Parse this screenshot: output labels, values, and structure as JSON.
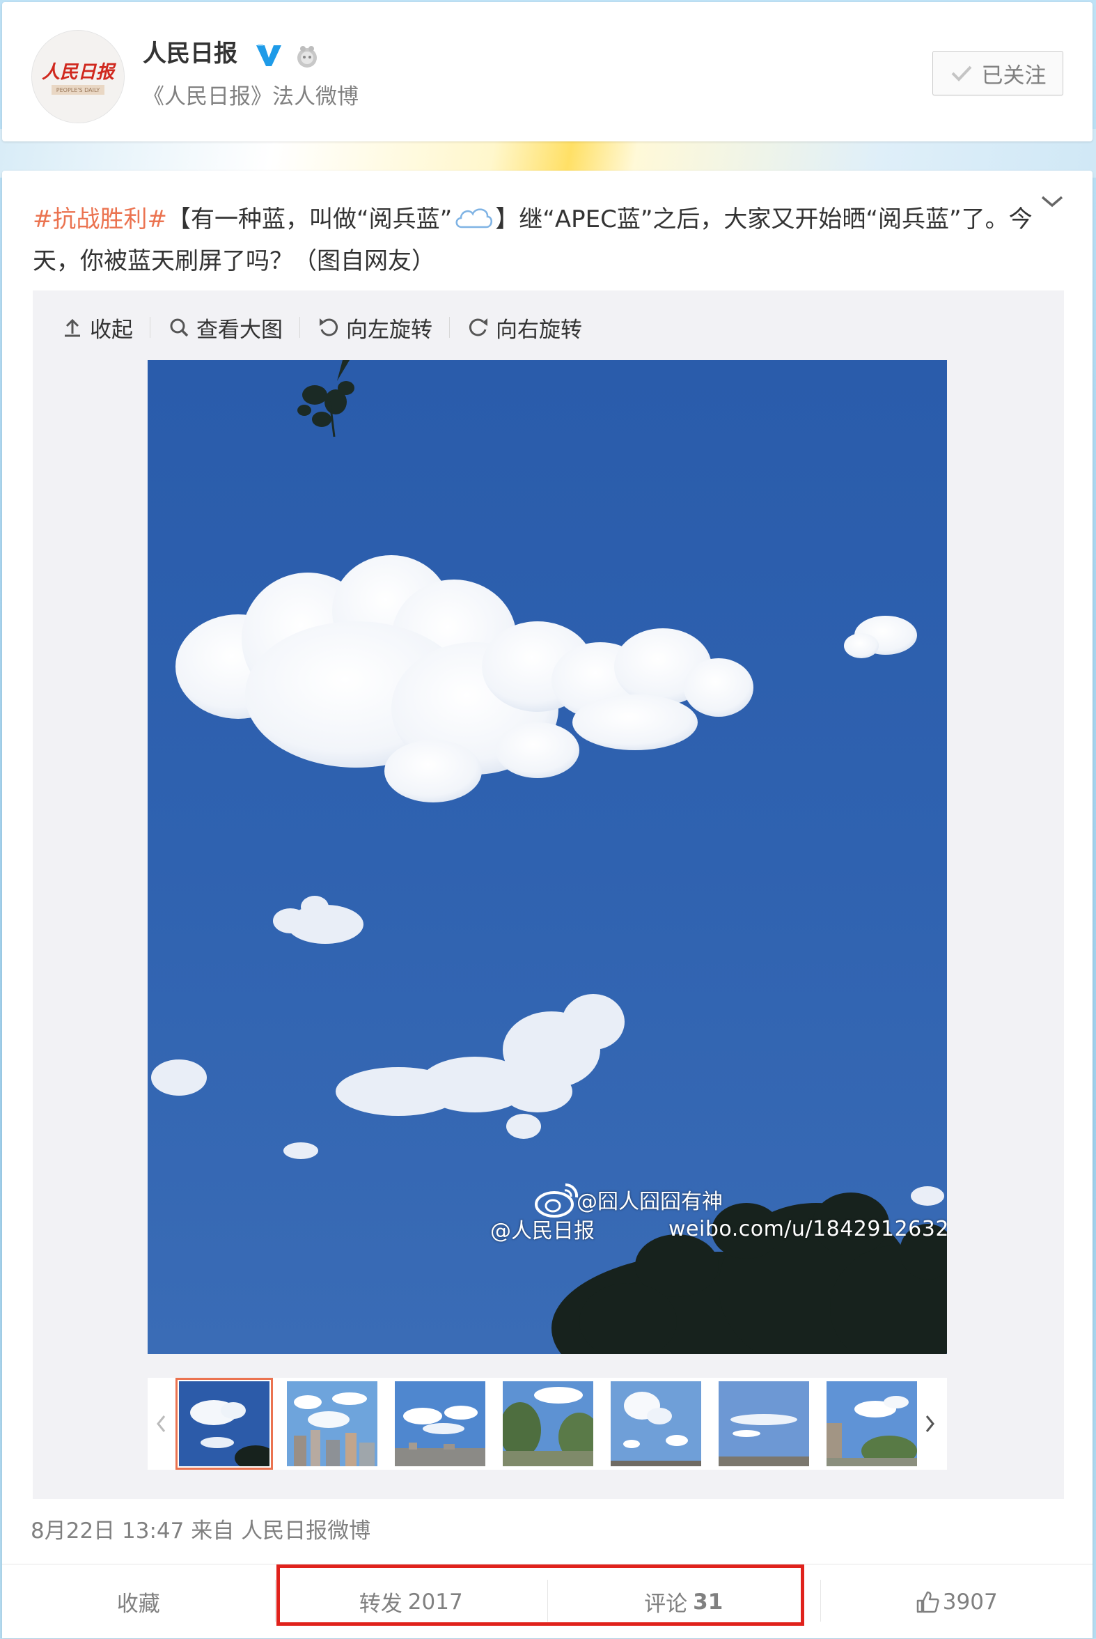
{
  "profile": {
    "name": "人民日报",
    "description": "《人民日报》法人微博",
    "avatar_logo_text": "人民日报",
    "avatar_logo_subtext": "PEOPLE'S DAILY",
    "follow_label": "已关注"
  },
  "post": {
    "topic": "#抗战胜利#",
    "text_before_emoji": "【有一种蓝，叫做“阅兵蓝”",
    "text_after_emoji": "】继“APEC蓝”之后，大家又开始晒“阅兵蓝”了。今天，你被蓝天刷屏了吗？（图自网友）",
    "toolbar": {
      "collapse": "收起",
      "view_large": "查看大图",
      "rotate_left": "向左旋转",
      "rotate_right": "向右旋转"
    },
    "watermark": {
      "handle": "@人民日报",
      "user": "@囧人囧囧有神",
      "url": "weibo.com/u/1842912632"
    },
    "thumbnail_count": 7,
    "active_thumbnail": 0,
    "time": "8月22日 13:47",
    "source_prefix": "来自",
    "source": "人民日报微博"
  },
  "actions": {
    "favorite": "收藏",
    "repost_label": "转发",
    "repost_count": "2017",
    "comment_label": "评论",
    "comment_count": "31",
    "like_count": "3907"
  },
  "colors": {
    "topic": "#eb7350",
    "verified": "#1e9be8",
    "highlight": "#e0221c",
    "sky": "#2e5da8"
  },
  "icons": [
    "verified-icon",
    "medal-icon",
    "check-icon",
    "chevron-down-icon",
    "upload-icon",
    "search-icon",
    "rotate-left-icon",
    "rotate-right-icon",
    "cloud-emoji-icon",
    "weibo-logo-icon",
    "chevron-left-icon",
    "chevron-right-icon",
    "like-icon"
  ]
}
